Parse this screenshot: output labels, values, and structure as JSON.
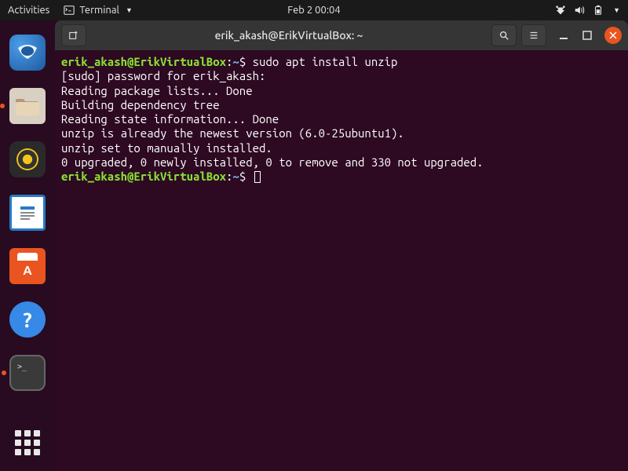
{
  "topbar": {
    "activities": "Activities",
    "app_name": "Terminal",
    "datetime": "Feb 2  00:04"
  },
  "window": {
    "title": "erik_akash@ErikVirtualBox: ~"
  },
  "terminal": {
    "prompt_user": "erik_akash@ErikVirtualBox",
    "prompt_sep": ":",
    "prompt_path": "~",
    "prompt_end": "$",
    "command1": "sudo apt install unzip",
    "lines": [
      "[sudo] password for erik_akash:",
      "Reading package lists... Done",
      "Building dependency tree",
      "Reading state information... Done",
      "unzip is already the newest version (6.0-25ubuntu1).",
      "unzip set to manually installed.",
      "0 upgraded, 0 newly installed, 0 to remove and 330 not upgraded."
    ]
  }
}
